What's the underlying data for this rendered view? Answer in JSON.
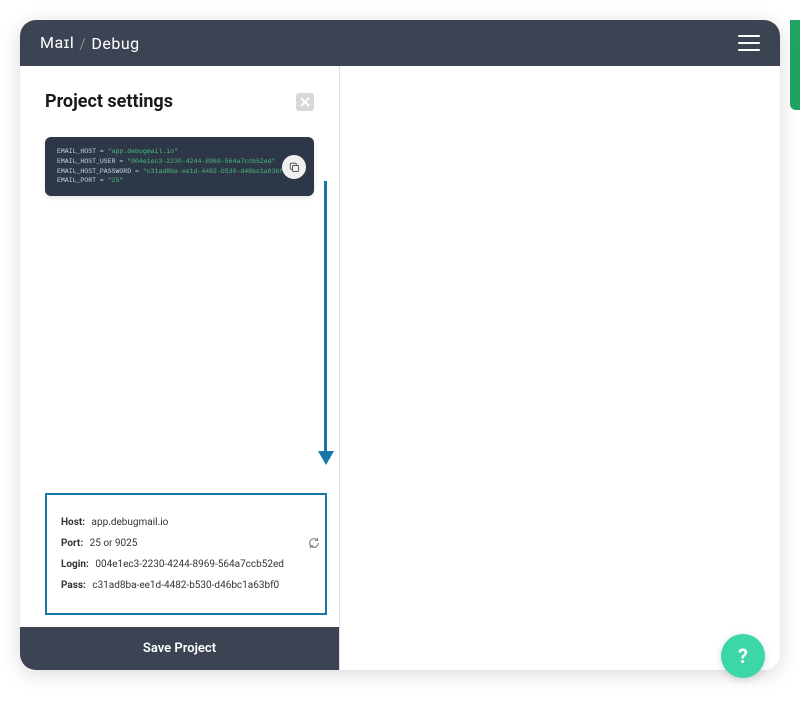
{
  "brand": {
    "part1": "Maɪl",
    "slash": "/",
    "part2": "Debug"
  },
  "panel": {
    "title": "Project settings",
    "code": {
      "lines": [
        {
          "key": "EMAIL_HOST",
          "value": "\"app.debugmail.io\""
        },
        {
          "key": "EMAIL_HOST_USER",
          "value": "\"004e1ec3-2230-4244-8969-564a7ccb52ed\""
        },
        {
          "key": "EMAIL_HOST_PASSWORD",
          "value": "\"c31ad8ba-ee1d-4482-b530-d46bc1a63bf0\""
        },
        {
          "key": "EMAIL_PORT",
          "value": "\"25\""
        }
      ]
    },
    "credentials": {
      "host_label": "Host:",
      "host_value": "app.debugmail.io",
      "port_label": "Port:",
      "port_value": "25 or 9025",
      "login_label": "Login:",
      "login_value": "004e1ec3-2230-4244-8969-564a7ccb52ed",
      "pass_label": "Pass:",
      "pass_value": "c31ad8ba-ee1d-4482-b530-d46bc1a63bf0"
    },
    "save_label": "Save Project"
  },
  "help_label": "?",
  "colors": {
    "header": "#3c4454",
    "accent_arrow": "#1976a8",
    "fab": "#3dd6a8",
    "code_bg": "#2d3748"
  }
}
